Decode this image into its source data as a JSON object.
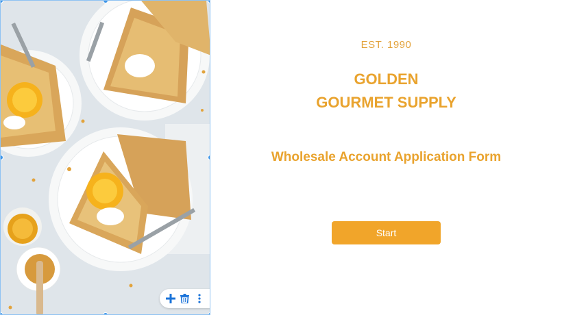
{
  "brand": {
    "established": "EST. 1990",
    "name_line1": "GOLDEN",
    "name_line2": "GOURMET SUPPLY"
  },
  "form": {
    "title": "Wholesale Account Application Form",
    "start_label": "Start"
  },
  "image_toolbar": {
    "icons": [
      "plus-icon",
      "trash-icon",
      "more-vertical-icon"
    ],
    "accent": "#1a73d9"
  },
  "colors": {
    "brand": "#e9a32e",
    "button": "#f1a52a",
    "selection": "#3d95e8"
  },
  "image": {
    "subject": "crepes with orange slices and cream on plates"
  }
}
